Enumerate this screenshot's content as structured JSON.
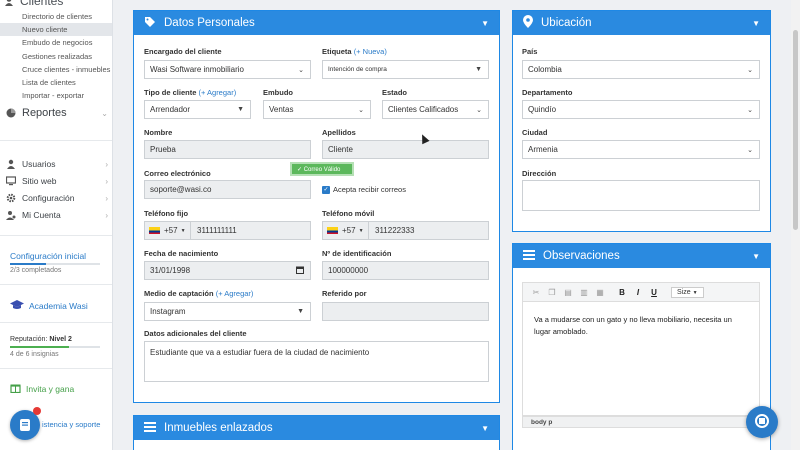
{
  "sidebar": {
    "top_title": "Clientes",
    "sub_items": [
      {
        "label": "Directorio de clientes",
        "active": false
      },
      {
        "label": "Nuevo cliente",
        "active": true
      },
      {
        "label": "Embudo de negocios",
        "active": false
      },
      {
        "label": "Gestiones realizadas",
        "active": false
      },
      {
        "label": "Cruce clientes - inmuebles",
        "active": false
      },
      {
        "label": "Lista de clientes",
        "active": false
      },
      {
        "label": "Importar - exportar",
        "active": false
      }
    ],
    "reportes": "Reportes",
    "items": [
      {
        "label": "Usuarios",
        "icon": "users-icon"
      },
      {
        "label": "Sitio web",
        "icon": "monitor-icon"
      },
      {
        "label": "Configuración",
        "icon": "gear-icon"
      },
      {
        "label": "Mi Cuenta",
        "icon": "user-icon"
      }
    ],
    "config_title": "Configuración inicial",
    "config_progress": 0.4,
    "config_sub": "2/3 completados",
    "academy": "Academia Wasi",
    "reputation_label": "Reputación: ",
    "reputation_level": "Nivel 2",
    "reputation_progress": 0.66,
    "reputation_sub": "4 de 6 insignias",
    "invite": "Invita y gana",
    "support": "istencia y soporte"
  },
  "personal": {
    "title": "Datos Personales",
    "encargado_label": "Encargado del cliente",
    "encargado_value": "Wasi Software inmobiliario",
    "etiqueta_label": "Etiqueta",
    "etiqueta_link": "(+ Nueva)",
    "etiqueta_value": "Intención de compra",
    "tipo_label": "Tipo de cliente",
    "tipo_link": "(+ Agregar)",
    "tipo_value": "Arrendador",
    "embudo_label": "Embudo",
    "embudo_value": "Ventas",
    "estado_label": "Estado",
    "estado_value": "Clientes Calificados",
    "nombre_label": "Nombre",
    "nombre_value": "Prueba",
    "apellidos_label": "Apellidos",
    "apellidos_value": "Cliente",
    "correo_label": "Correo electrónico",
    "correo_value": "soporte@wasi.co",
    "correo_tooltip": "✓ Correo Válido",
    "acepta_label": "Acepta recibir correos",
    "telfijo_label": "Teléfono fijo",
    "telfijo_code": "+57",
    "telfijo_value": "3111111111",
    "telmovil_label": "Teléfono móvil",
    "telmovil_code": "+57",
    "telmovil_value": "311222333",
    "nacimiento_label": "Fecha de nacimiento",
    "nacimiento_value": "31/01/1998",
    "identificacion_label": "Nº de identificación",
    "identificacion_value": "100000000",
    "medio_label": "Medio de captación",
    "medio_link": "(+ Agregar)",
    "medio_value": "Instagram",
    "referido_label": "Referido por",
    "referido_value": "",
    "adicionales_label": "Datos adicionales del cliente",
    "adicionales_value": "Estudiante que va a estudiar fuera de la ciudad de nacimiento"
  },
  "inmuebles": {
    "title": "Inmuebles enlazados"
  },
  "ubicacion": {
    "title": "Ubicación",
    "pais_label": "País",
    "pais_value": "Colombia",
    "depto_label": "Departamento",
    "depto_value": "Quindío",
    "ciudad_label": "Ciudad",
    "ciudad_value": "Armenia",
    "direccion_label": "Dirección",
    "direccion_value": ""
  },
  "observaciones": {
    "title": "Observaciones",
    "size_label": "Size",
    "text": "Va a mudarse con un gato y no lleva mobiliario, necesita un lugar amoblado.",
    "footer": "body   p"
  }
}
